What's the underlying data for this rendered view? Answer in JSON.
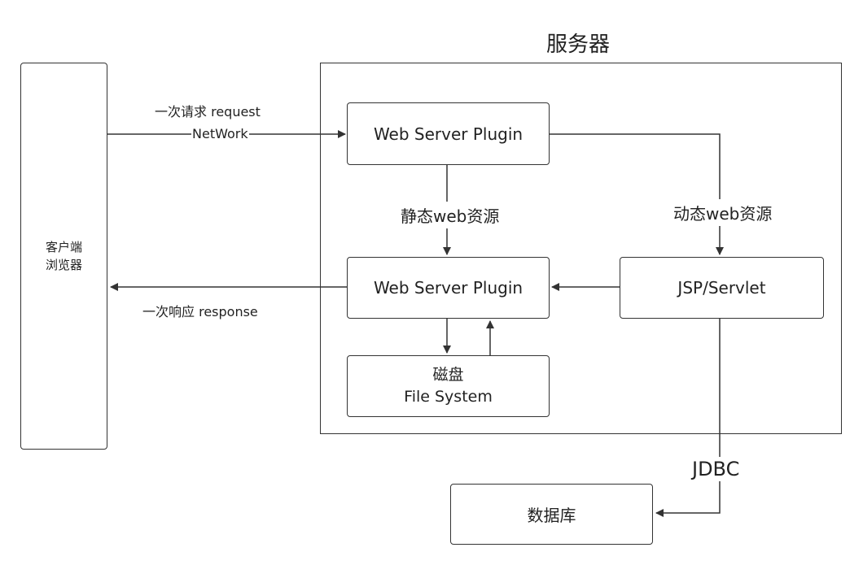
{
  "server_title": "服务器",
  "client": {
    "line1": "客户端",
    "line2": "浏览器"
  },
  "nodes": {
    "plugin_top": "Web Server Plugin",
    "plugin_bottom": "Web Server Plugin",
    "jsp_servlet": "JSP/Servlet",
    "disk_line1": "磁盘",
    "disk_line2": "File System",
    "database": "数据库"
  },
  "edges": {
    "request": "一次请求 request",
    "network": "NetWork",
    "response": "一次响应 response",
    "static_res": "静态web资源",
    "dynamic_res": "动态web资源",
    "jdbc": "JDBC"
  }
}
